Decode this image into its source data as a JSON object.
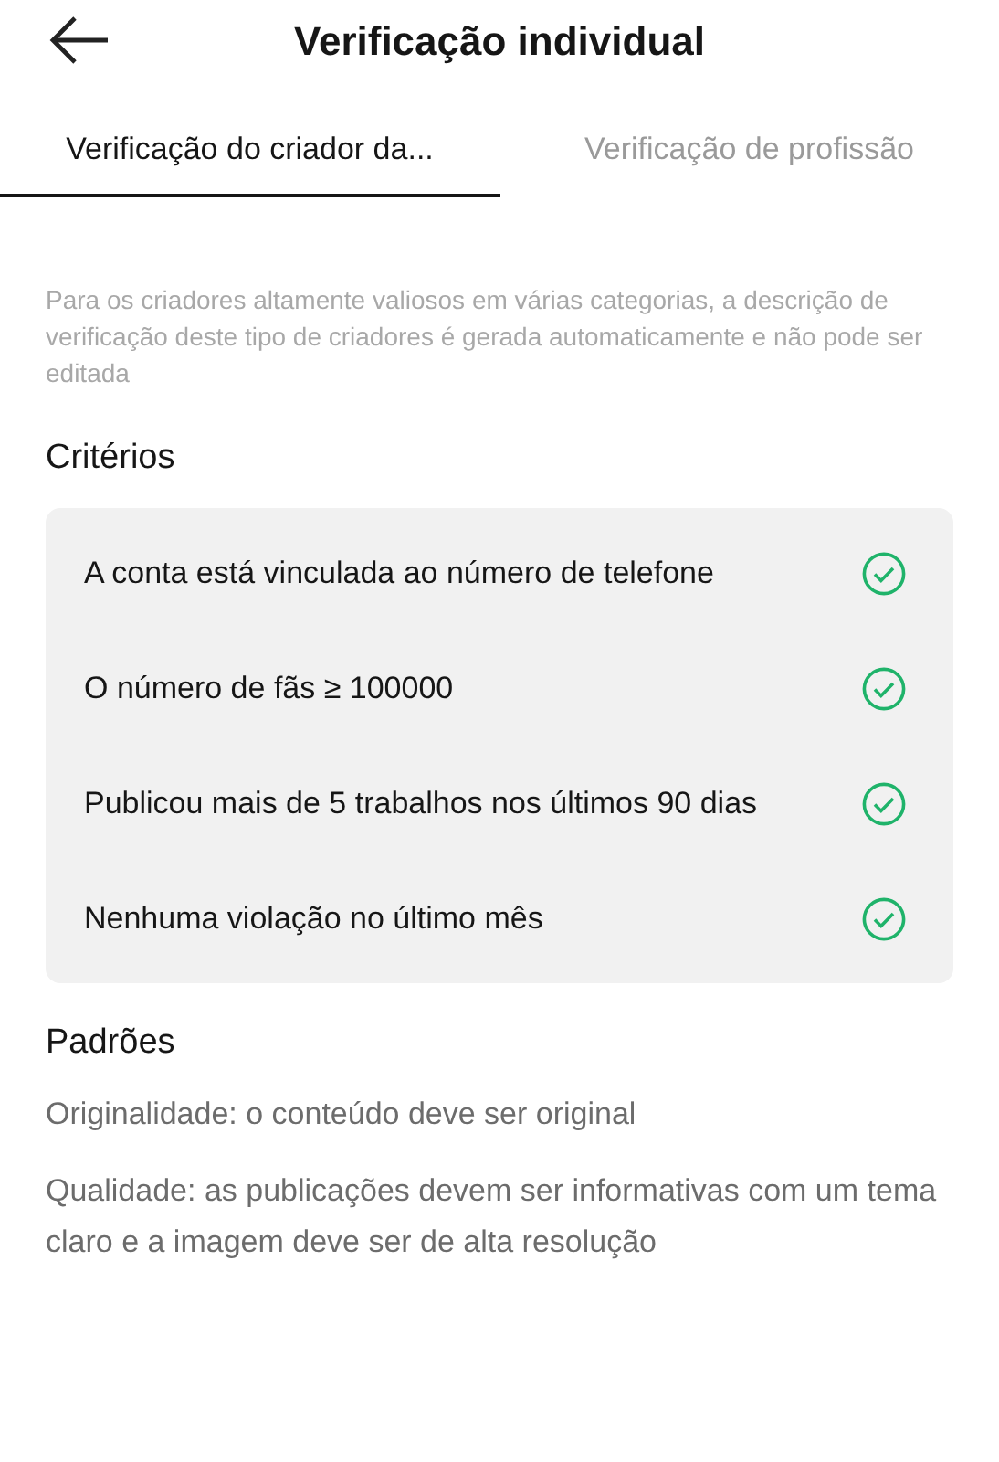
{
  "header": {
    "title": "Verificação individual"
  },
  "tabs": [
    {
      "label": "Verificação do criador da...",
      "selected": true
    },
    {
      "label": "Verificação de profissão",
      "selected": false
    }
  ],
  "description": "Para os criadores altamente valiosos em várias categorias, a descrição de verificação deste tipo de criadores é gerada automaticamente e não pode ser editada",
  "criteria": {
    "heading": "Critérios",
    "items": [
      {
        "text": "A conta está vinculada ao número de telefone",
        "met": true
      },
      {
        "text": "O número de fãs ≥ 100000",
        "met": true
      },
      {
        "text": "Publicou mais de 5 trabalhos nos últimos 90 dias",
        "met": true
      },
      {
        "text": "Nenhuma violação no último mês",
        "met": true
      }
    ]
  },
  "standards": {
    "heading": "Padrões",
    "items": [
      "Originalidade: o conteúdo deve ser original",
      "Qualidade: as publicações devem ser informativas com um tema claro e a imagem deve ser de alta resolução"
    ]
  }
}
